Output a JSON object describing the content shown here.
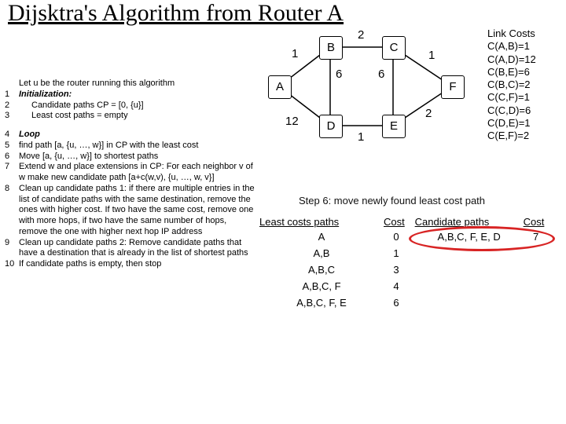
{
  "title": "Dijsktra's Algorithm from Router A",
  "algorithm": {
    "intro": "Let u be the router running this algorithm",
    "lines": [
      {
        "n": "1",
        "t": "Initialization:",
        "style": "bolditalic"
      },
      {
        "n": "2",
        "t": "Candidate paths CP = [0, {u}]",
        "style": "indent1"
      },
      {
        "n": "3",
        "t": "Least cost paths = empty",
        "style": "indent1"
      },
      {
        "gap": true
      },
      {
        "n": "4",
        "t": "Loop",
        "style": "bolditalic"
      },
      {
        "n": "5",
        "t": "find path [a, {u, …, w}] in CP with the least cost"
      },
      {
        "n": "6",
        "t": "Move [a, {u, …, w}] to shortest paths"
      },
      {
        "n": "7",
        "t": "Extend w and place extensions in CP: For each neighbor v of w make new candidate path [a+c(w,v), {u, …, w, v}]"
      },
      {
        "n": "8",
        "t": "Clean up candidate paths 1: if there are multiple entries in the list of candidate paths with the same destination, remove the ones with higher cost. If two have the same cost, remove one with more hops, if two have the same number of hops, remove the one with higher next hop IP address"
      },
      {
        "n": "9",
        "t": "Clean up candidate paths 2: Remove candidate paths that have a destination that is already in the list of shortest paths"
      },
      {
        "n": "10",
        "t": "If candidate paths is empty, then stop"
      }
    ]
  },
  "graph": {
    "nodes": [
      "A",
      "B",
      "C",
      "D",
      "E",
      "F"
    ],
    "edge_labels": {
      "AB": "1",
      "BC": "2",
      "CF": "1",
      "BD": "6",
      "CE": "6",
      "AD": "12",
      "DE": "1",
      "EF": "2"
    }
  },
  "link_costs": {
    "heading": "Link Costs",
    "items": [
      "C(A,B)=1",
      "C(A,D)=12",
      "C(B,E)=6",
      "C(B,C)=2",
      "C(C,F)=1",
      "C(C,D)=6",
      "C(D,E)=1",
      "C(E,F)=2"
    ]
  },
  "step_caption": "Step 6: move newly found least cost path",
  "tables": {
    "least": {
      "head_path": "Least costs paths",
      "head_cost": "Cost",
      "rows": [
        {
          "p": "A",
          "c": "0"
        },
        {
          "p": "A,B",
          "c": "1"
        },
        {
          "p": "A,B,C",
          "c": "3"
        },
        {
          "p": "A,B,C, F",
          "c": "4"
        },
        {
          "p": "A,B,C, F, E",
          "c": "6"
        }
      ]
    },
    "candidate": {
      "head_path": "Candidate paths",
      "head_cost": "Cost",
      "rows": [
        {
          "p": "A,B,C, F, E, D",
          "c": "7"
        }
      ]
    }
  }
}
